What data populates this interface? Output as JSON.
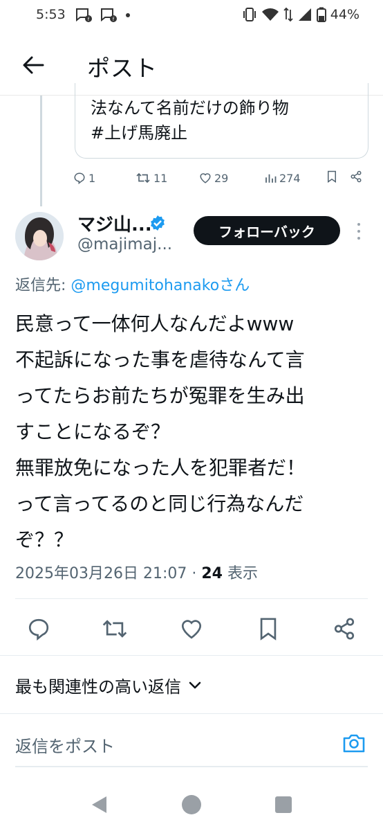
{
  "status_bar": {
    "time": "5:53",
    "battery": "44%"
  },
  "header": {
    "title": "ポスト"
  },
  "parent_post": {
    "quote_lines": [
      "法なんて名前だけの飾り物",
      "#上げ馬廃止"
    ],
    "replies": "1",
    "reposts": "11",
    "likes": "29",
    "views": "274"
  },
  "post": {
    "display_name": "マジ山...",
    "handle": "@majimaj...",
    "follow_label": "フォローバック",
    "reply_prefix": "返信先: ",
    "reply_handle": "@megumitohanako",
    "reply_suffix": "さん",
    "text": "民意って一体何人なんだよwww\n不起訴になった事を虐待なんて言\nってたらお前たちが冤罪を生み出\nすことになるぞ？\n無罪放免になった人を犯罪者だ！\nって言ってるのと同じ行為なんだ\nぞ？？",
    "timestamp": "2025年03月26日 21:07",
    "separator": " · ",
    "views_count": "24",
    "views_label": " 表示"
  },
  "replies_section": {
    "sort_label": "最も関連性の高い返信",
    "reply_placeholder": "返信をポスト"
  },
  "colors": {
    "accent": "#1d9bf0",
    "text": "#0f1419",
    "muted": "#536471",
    "follow_bg": "#0f1419"
  }
}
